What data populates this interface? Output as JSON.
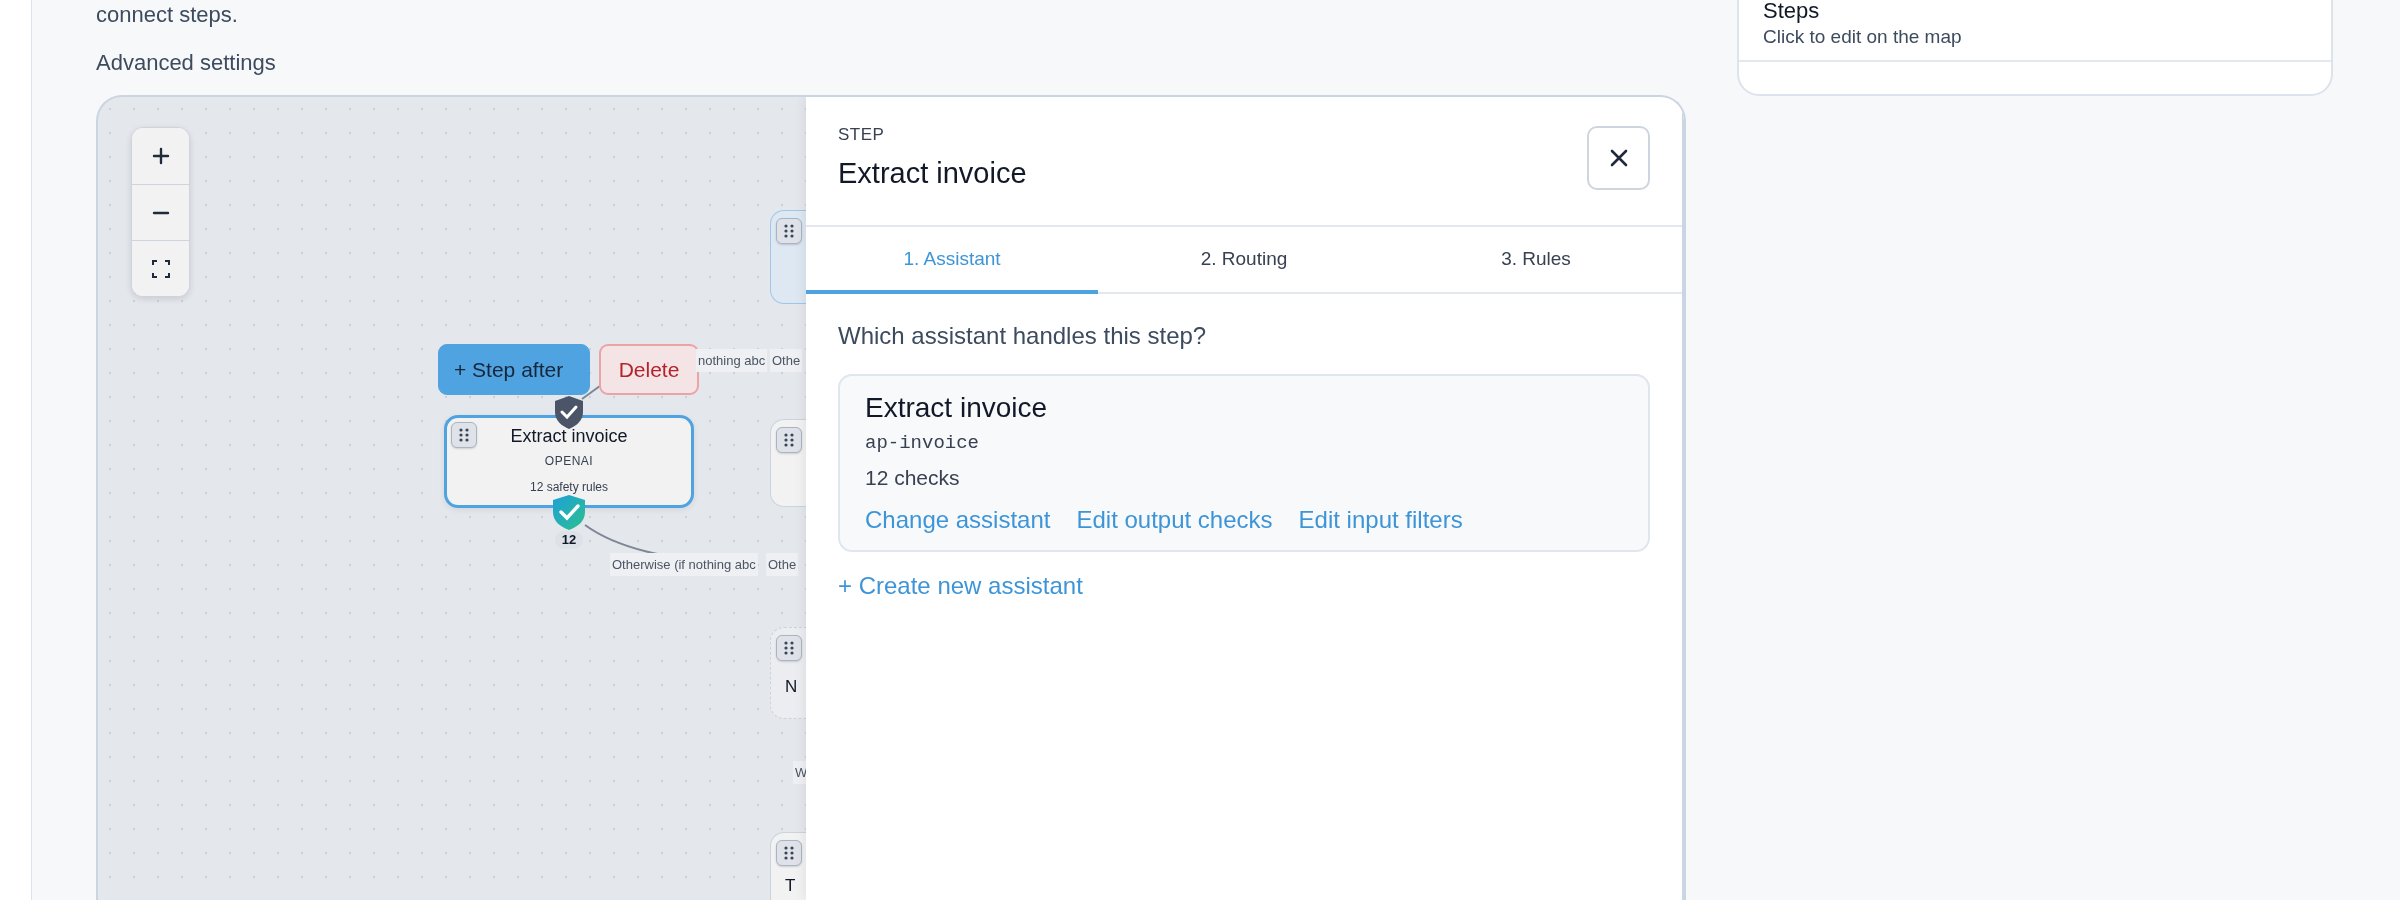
{
  "intro": {
    "description": "connect steps.",
    "section_label": "Advanced settings"
  },
  "canvas": {
    "zoom_controls": [
      {
        "kind": "zoom_in"
      },
      {
        "kind": "zoom_out"
      },
      {
        "kind": "fit"
      }
    ],
    "node_actions": [
      {
        "kind": "primary",
        "label": "+ Step after"
      },
      {
        "kind": "danger",
        "label": "Delete"
      }
    ],
    "selected_node": {
      "title": "Extract invoice",
      "provider": "OPENAI",
      "rules": "12 safety rules",
      "selected": true,
      "rule_count": "12"
    },
    "edge_labels": [
      {
        "text": "nothing abc"
      },
      {
        "text": "Othe"
      },
      {
        "text": "Otherwise (if nothing abc"
      },
      {
        "text": "Othe"
      },
      {
        "text": "W"
      }
    ],
    "partial_nodes": [
      {
        "kind": "highlighted"
      },
      {
        "kind": "plain"
      },
      {
        "kind": "dashed",
        "label": "N"
      },
      {
        "kind": "plain",
        "label": "T"
      }
    ]
  },
  "panel": {
    "eyebrow": "STEP",
    "title": "Extract invoice",
    "tabs": [
      {
        "label": "1. Assistant",
        "selected": true
      },
      {
        "label": "2. Routing",
        "selected": false
      },
      {
        "label": "3. Rules",
        "selected": false
      }
    ],
    "question": "Which assistant handles this step?",
    "assistant": {
      "name": "Extract invoice",
      "slug": "ap-invoice",
      "checks": "12 checks",
      "links": [
        "Change assistant",
        "Edit output checks",
        "Edit input filters"
      ]
    },
    "create_link": "+ Create new assistant"
  },
  "steps_card": {
    "title": "Steps",
    "subtitle": "Click to edit on the map"
  }
}
